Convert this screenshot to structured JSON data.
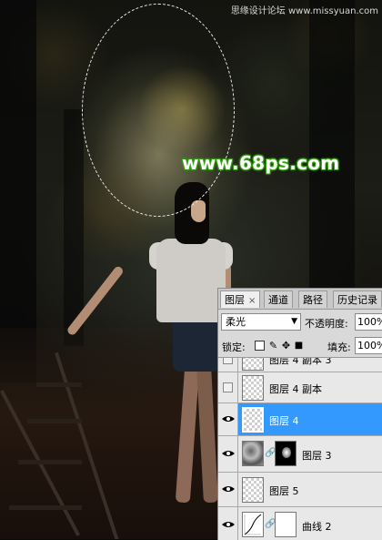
{
  "watermark": {
    "site": "www.68ps.com",
    "credit": "思缘设计论坛  www.missyuan.com"
  },
  "layers_panel": {
    "tabs": [
      {
        "label": "图层",
        "close": "×",
        "active": true
      },
      {
        "label": "通道",
        "active": false
      },
      {
        "label": "路径",
        "active": false
      },
      {
        "label": "历史记录",
        "active": false
      }
    ],
    "blend_mode": "柔光",
    "opacity_label": "不透明度:",
    "opacity_value": "100%",
    "lock_label": "锁定:",
    "fill_label": "填充:",
    "fill_value": "100%",
    "layers": [
      {
        "name": "图层 4 副本 3",
        "visible": false,
        "selected": false
      },
      {
        "name": "图层 4 副本",
        "visible": false,
        "selected": false
      },
      {
        "name": "图层 4",
        "visible": true,
        "selected": true
      },
      {
        "name": "图层 3",
        "visible": true,
        "selected": false,
        "has_mask": true
      },
      {
        "name": "图层 5",
        "visible": true,
        "selected": false
      },
      {
        "name": "曲线 2",
        "visible": true,
        "selected": false,
        "adjustment": true
      }
    ]
  },
  "colors": {
    "selection": "#3399ff",
    "panel_bg": "#d9d9d9",
    "watermark_glow": "#3fae1a"
  }
}
